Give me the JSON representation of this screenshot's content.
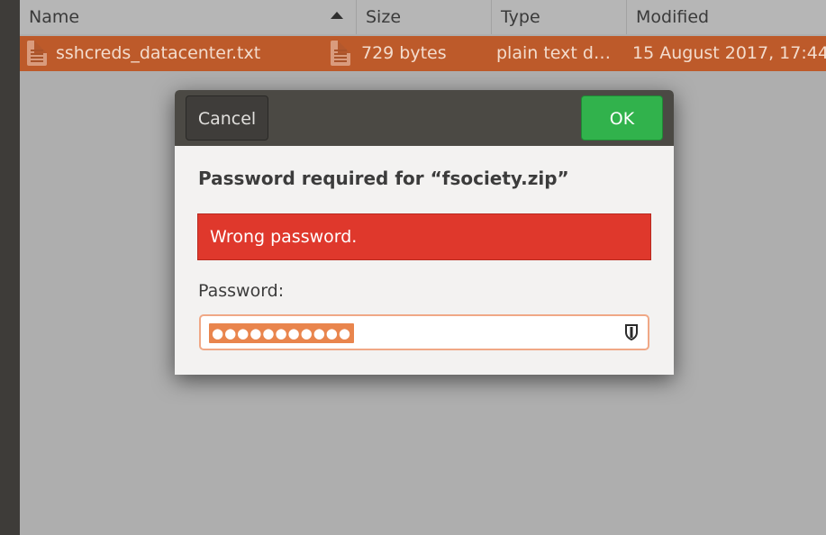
{
  "filelist": {
    "columns": {
      "name": "Name",
      "size": "Size",
      "type": "Type",
      "modified": "Modified"
    },
    "sort": "name-ascending",
    "rows": [
      {
        "name": "sshcreds_datacenter.txt",
        "size": "729 bytes",
        "type": "plain text d…",
        "modified": "15 August 2017, 17:44",
        "icon": "text-file-icon",
        "selected": true
      }
    ]
  },
  "dialog": {
    "cancel_label": "Cancel",
    "ok_label": "OK",
    "title": "Password required for “fsociety.zip”",
    "error": "Wrong password.",
    "password_label": "Password:",
    "password_value": "●●●●●●●●●●●",
    "reveal_icon": "shield-icon"
  },
  "colors": {
    "selection": "#bd5a2a",
    "ok_button": "#31b24c",
    "error_bar": "#df382c",
    "header_bar": "#4b4944"
  }
}
